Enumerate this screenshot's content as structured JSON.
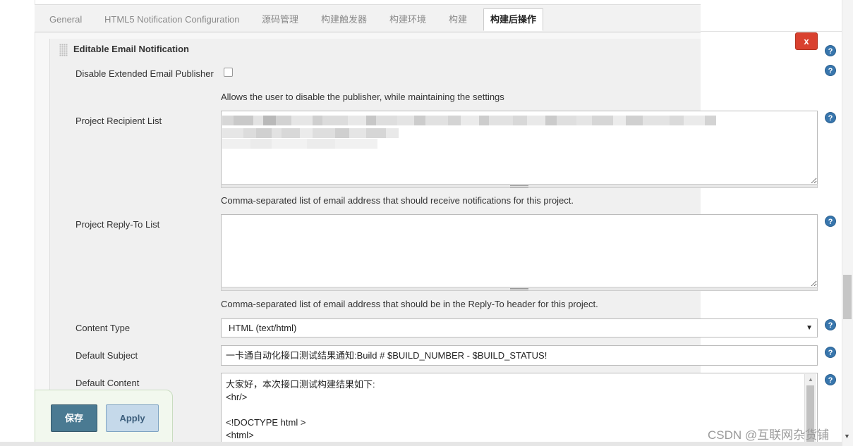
{
  "tabs": [
    {
      "label": "General"
    },
    {
      "label": "HTML5 Notification Configuration"
    },
    {
      "label": "源码管理"
    },
    {
      "label": "构建触发器"
    },
    {
      "label": "构建环境"
    },
    {
      "label": "构建"
    },
    {
      "label": "构建后操作",
      "active": true
    }
  ],
  "section": {
    "title": "Editable Email Notification",
    "delete_label": "x"
  },
  "help_label": "?",
  "fields": {
    "disable_publisher": {
      "label": "Disable Extended Email Publisher",
      "checked": false,
      "description": "Allows the user to disable the publisher, while maintaining the settings"
    },
    "recipient_list": {
      "label": "Project Recipient List",
      "description": "Comma-separated list of email address that should receive notifications for this project."
    },
    "reply_to_list": {
      "label": "Project Reply-To List",
      "value": "",
      "description": "Comma-separated list of email address that should be in the Reply-To header for this project."
    },
    "content_type": {
      "label": "Content Type",
      "value": "HTML (text/html)"
    },
    "default_subject": {
      "label": "Default Subject",
      "value": "一卡通自动化接口测试结果通知:Build # $BUILD_NUMBER - $BUILD_STATUS!"
    },
    "default_content": {
      "label": "Default Content",
      "lines": [
        "大家好，本次接口测试构建结果如下:",
        "<hr/>",
        "",
        "<!DOCTYPE html >",
        "<html>"
      ]
    }
  },
  "buttons": {
    "save": "保存",
    "apply": "Apply"
  },
  "watermark": "CSDN @互联网杂货铺"
}
